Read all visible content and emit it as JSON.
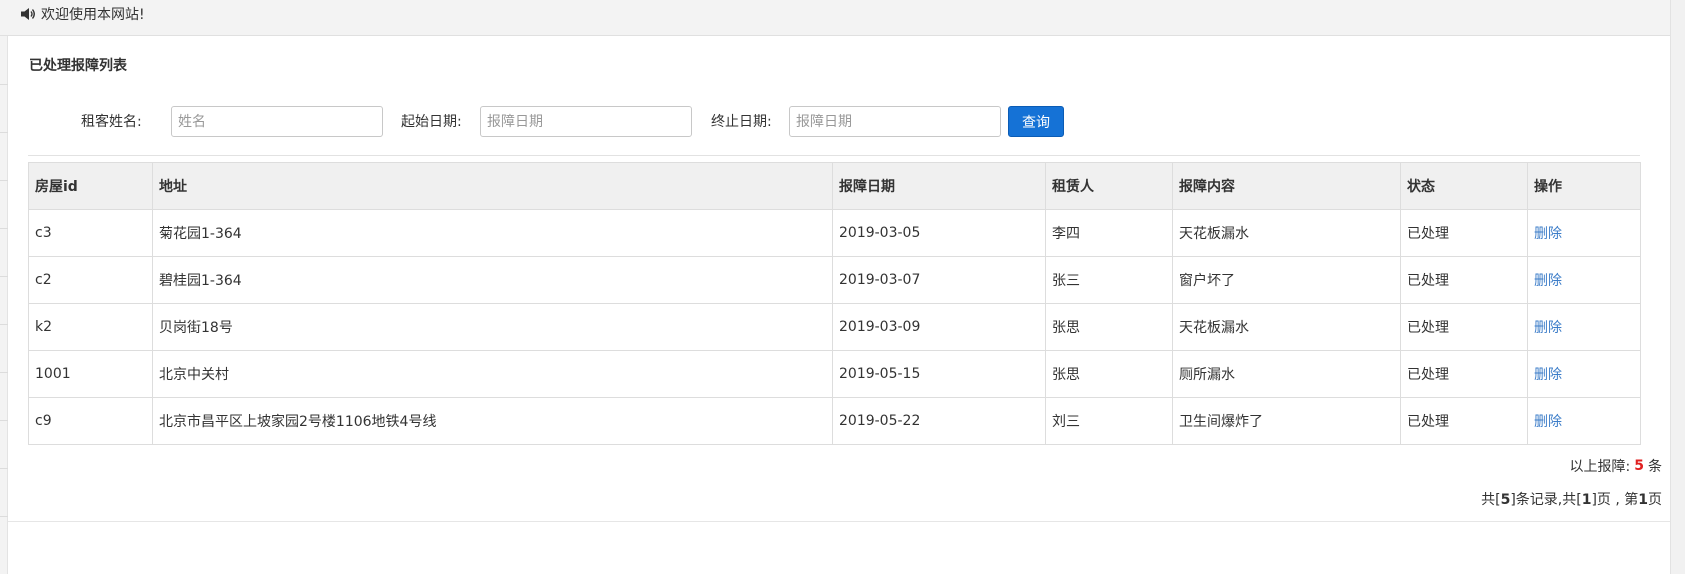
{
  "topbar": {
    "welcome_text": "欢迎使用本网站!",
    "icon": "speaker-icon"
  },
  "page": {
    "title": "已处理报障列表"
  },
  "search": {
    "tenant_label": "租客姓名:",
    "tenant_placeholder": "姓名",
    "start_label": "起始日期:",
    "start_placeholder": "报障日期",
    "end_label": "终止日期:",
    "end_placeholder": "报障日期",
    "button_label": "查询"
  },
  "table": {
    "headers": [
      "房屋id",
      "地址",
      "报障日期",
      "租赁人",
      "报障内容",
      "状态",
      "操作"
    ],
    "rows": [
      {
        "house_id": "c3",
        "address": "菊花园1-364",
        "date": "2019-03-05",
        "tenant": "李四",
        "content": "天花板漏水",
        "status": "已处理",
        "action": "删除"
      },
      {
        "house_id": "c2",
        "address": "碧桂园1-364",
        "date": "2019-03-07",
        "tenant": "张三",
        "content": "窗户坏了",
        "status": "已处理",
        "action": "删除"
      },
      {
        "house_id": "k2",
        "address": "贝岗街18号",
        "date": "2019-03-09",
        "tenant": "张思",
        "content": "天花板漏水",
        "status": "已处理",
        "action": "删除"
      },
      {
        "house_id": "1001",
        "address": "北京中关村",
        "date": "2019-05-15",
        "tenant": "张思",
        "content": "厕所漏水",
        "status": "已处理",
        "action": "删除"
      },
      {
        "house_id": "c9",
        "address": "北京市昌平区上坡家园2号楼1106地铁4号线",
        "date": "2019-05-22",
        "tenant": "刘三",
        "content": "卫生间爆炸了",
        "status": "已处理",
        "action": "删除"
      }
    ]
  },
  "summary": {
    "prefix": "以上报障:",
    "count": "5",
    "suffix": "条"
  },
  "pagination": {
    "text_1": "共[",
    "total_records": "5",
    "text_2": "]条记录,共[",
    "total_pages": "1",
    "text_3": "]页 , 第",
    "current_page": "1",
    "text_4": "页"
  },
  "colors": {
    "primary_button": "#1572d6",
    "link": "#3b7cc8",
    "count_highlight": "#e02020"
  }
}
